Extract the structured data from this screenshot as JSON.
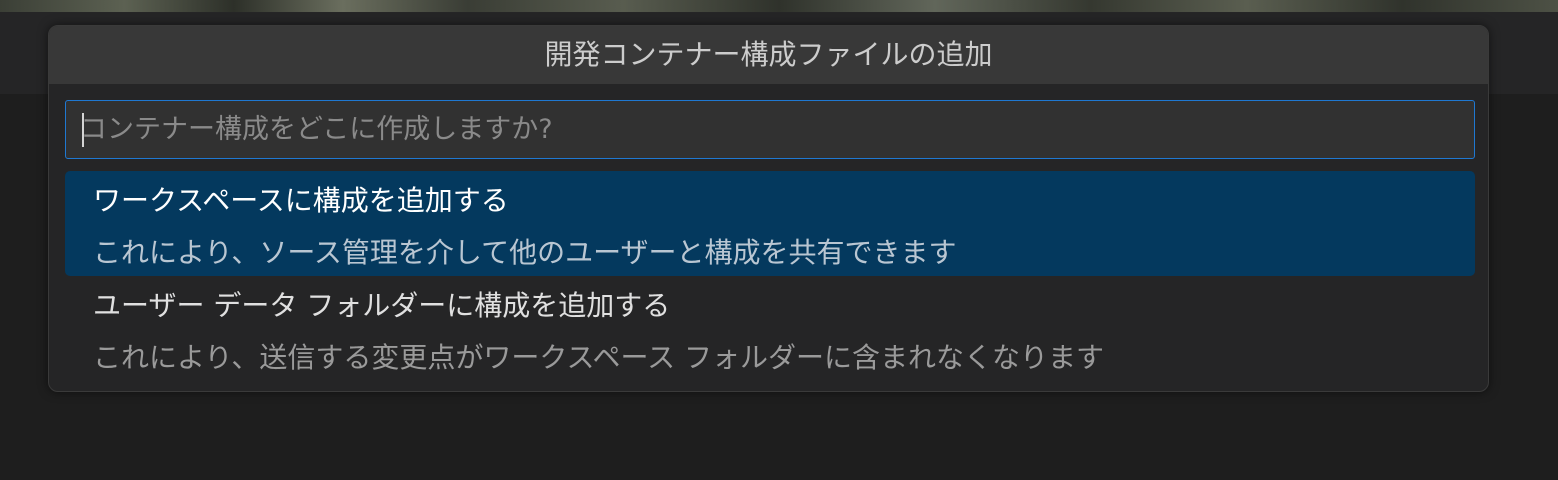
{
  "quick_input": {
    "title": "開発コンテナー構成ファイルの追加",
    "placeholder": "コンテナー構成をどこに作成しますか?",
    "value": "",
    "items": [
      {
        "label": "ワークスペースに構成を追加する",
        "description": "これにより、ソース管理を介して他のユーザーと構成を共有できます",
        "selected": true
      },
      {
        "label": "ユーザー データ フォルダーに構成を追加する",
        "description": "これにより、送信する変更点がワークスペース フォルダーに含まれなくなります",
        "selected": false
      }
    ]
  },
  "colors": {
    "selection_background": "#04395e",
    "focus_border": "#1f78d1",
    "editor_background": "#1e1e1e"
  }
}
